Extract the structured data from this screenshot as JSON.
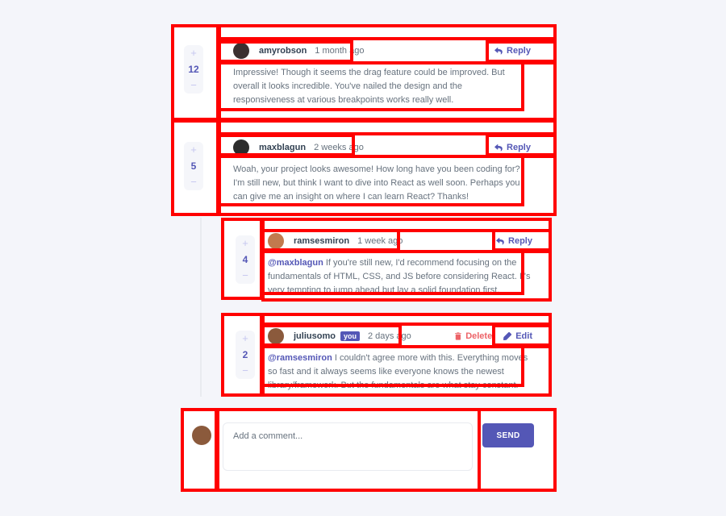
{
  "colors": {
    "primary": "#5457b6",
    "danger": "#ed6368",
    "text": "#67727e",
    "heading": "#334253",
    "background": "#f4f5fa",
    "annotation": "#ff0000"
  },
  "comments": [
    {
      "avatar_color": "#3b3030",
      "username": "amyrobson",
      "time": "1 month ago",
      "score": "12",
      "upvote": "+",
      "downvote": "−",
      "reply_label": "Reply",
      "content": "Impressive! Though it seems the drag feature could be improved. But overall it looks incredible. You've nailed the design and the responsiveness at various breakpoints works really well."
    },
    {
      "avatar_color": "#2c2c2c",
      "username": "maxblagun",
      "time": "2 weeks ago",
      "score": "5",
      "upvote": "+",
      "downvote": "−",
      "reply_label": "Reply",
      "content": "Woah, your project looks awesome! How long have you been coding for? I'm still new, but think I want to dive into React as well soon. Perhaps you can give me an insight on where I can learn React? Thanks!"
    }
  ],
  "replies": [
    {
      "avatar_color": "#c27a4e",
      "username": "ramsesmiron",
      "time": "1 week ago",
      "score": "4",
      "upvote": "+",
      "downvote": "−",
      "reply_label": "Reply",
      "mention": "@maxblagun",
      "content": " If you're still new, I'd recommend focusing on the fundamentals of HTML, CSS, and JS before considering React. It's very tempting to jump ahead but lay a solid foundation first."
    },
    {
      "avatar_color": "#8b5a3c",
      "username": "juliusomo",
      "you_badge": "you",
      "time": "2 days ago",
      "score": "2",
      "upvote": "+",
      "downvote": "−",
      "delete_label": "Delete",
      "edit_label": "Edit",
      "mention": "@ramsesmiron",
      "content": " I couldn't agree more with this. Everything moves so fast and it always seems like everyone knows the newest library/framework. But the fundamentals are what stay constant."
    }
  ],
  "new_comment": {
    "avatar_color": "#8b5a3c",
    "placeholder": "Add a comment...",
    "send_label": "SEND"
  }
}
